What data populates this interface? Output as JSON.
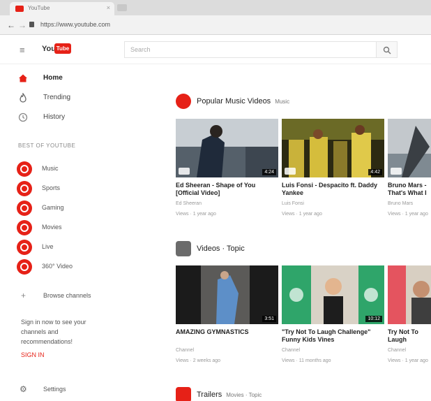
{
  "browser": {
    "tab_title": "YouTube",
    "tab_close": "×",
    "url": "https://www.youtube.com",
    "back": "←",
    "forward": "→"
  },
  "masthead": {
    "menu_icon": "≡",
    "logo_text": "You",
    "logo_badge": "Tube",
    "search_placeholder": "Search"
  },
  "sidebar": {
    "nav": [
      {
        "label": "Home",
        "icon": "home-icon"
      },
      {
        "label": "Trending",
        "icon": "flame-icon"
      },
      {
        "label": "History",
        "icon": "history-icon"
      }
    ],
    "section_title": "BEST OF YOUTUBE",
    "subscriptions": [
      {
        "label": "Music"
      },
      {
        "label": "Sports"
      },
      {
        "label": "Gaming"
      },
      {
        "label": "Movies"
      },
      {
        "label": "Live"
      },
      {
        "label": "360° Video"
      }
    ],
    "browse_label": "Browse channels",
    "browse_icon": "+",
    "signin_text": "Sign in now to see your channels and recommendations!",
    "signin_link": "SIGN IN",
    "settings_label": "Settings",
    "settings_icon": "⚙"
  },
  "feed": {
    "sections": [
      {
        "title": "Popular Music Videos",
        "subtitle": "Music",
        "videos": [
          {
            "title": "Ed Sheeran - Shape of You [Official Video]",
            "channel": "Ed Sheeran",
            "meta": "Views · 1 year ago",
            "duration": "4:24"
          },
          {
            "title": "Luis Fonsi - Despacito ft. Daddy Yankee",
            "channel": "Luis Fonsi",
            "meta": "Views · 1 year ago",
            "duration": "4:42"
          },
          {
            "title": "Bruno Mars - That's What I Like",
            "channel": "Bruno Mars",
            "meta": "Views · 1 year ago",
            "duration": ""
          }
        ]
      },
      {
        "title": "Videos · Topic",
        "subtitle": "",
        "videos": [
          {
            "title": "AMAZING GYMNASTICS",
            "channel": "Channel",
            "meta": "Views · 2 weeks ago",
            "duration": "3:51"
          },
          {
            "title": "\"Try Not To Laugh Challenge\" Funny Kids Vines",
            "channel": "Channel",
            "meta": "Views · 11 months ago",
            "duration": "10:12"
          },
          {
            "title": "Try Not To Laugh Challenge",
            "channel": "Channel",
            "meta": "Views · 1 year ago",
            "duration": ""
          }
        ]
      },
      {
        "title": "Trailers",
        "subtitle": "Movies · Topic",
        "videos": []
      }
    ]
  },
  "colors": {
    "accent": "#e62117",
    "background": "#ffffff"
  }
}
